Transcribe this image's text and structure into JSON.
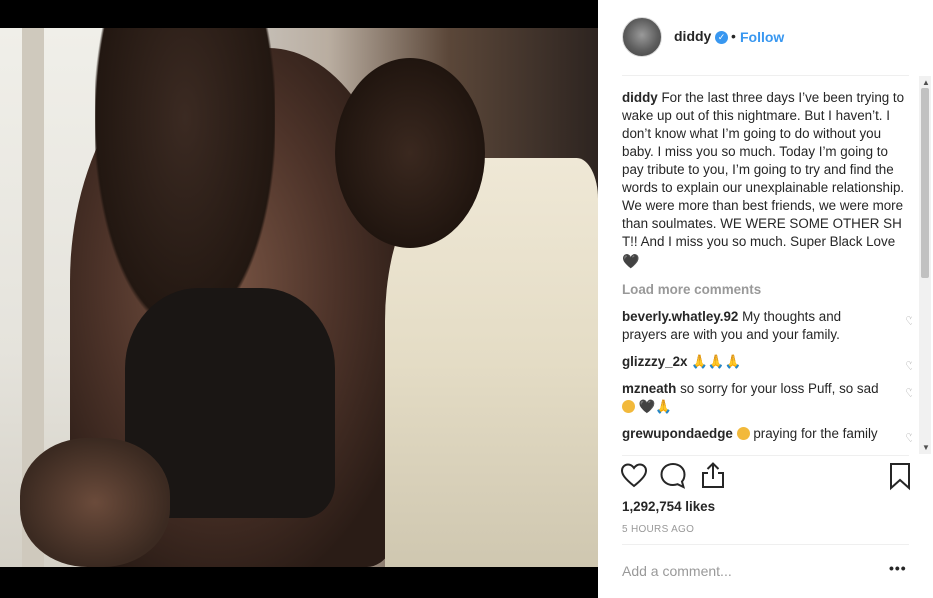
{
  "header": {
    "username": "diddy",
    "separator": "•",
    "follow_label": "Follow",
    "verified_mark": "✓"
  },
  "caption": {
    "username": "diddy",
    "text": "For the last three days I’ve been trying to wake up out of this nightmare. But I haven’t. I don’t know what I’m going to do without you baby. I miss you so much. Today I’m going to pay tribute to you, I’m going to try and find the words to explain our unexplainable relationship. We were more than best friends, we were more than soulmates. WE WERE SOME OTHER SH T!! And I miss you so much. Super Black Love",
    "emoji": "🖤"
  },
  "load_more": "Load more comments",
  "comments": [
    {
      "username": "beverly.whatley.92",
      "text": "My thoughts and prayers are with you and your family."
    },
    {
      "username": "glizzzy_2x",
      "text": "🙏🙏🙏"
    },
    {
      "username": "mzneath",
      "text": "so sorry for your loss Puff, so sad",
      "emoji": "🖤🙏"
    },
    {
      "username": "grewupondaedge",
      "text": "praying for the family"
    }
  ],
  "likes": "1,292,754 likes",
  "timestamp": "5 HOURS AGO",
  "add_comment_placeholder": "Add a comment...",
  "more_options": "•••",
  "icons": {
    "like": "heart-outline-icon",
    "comment": "comment-bubble-icon",
    "share": "share-upload-icon",
    "save": "bookmark-icon",
    "comment_like": "small-heart-outline-icon"
  },
  "colors": {
    "accent": "#3897f0",
    "text": "#262626",
    "muted": "#999999"
  }
}
